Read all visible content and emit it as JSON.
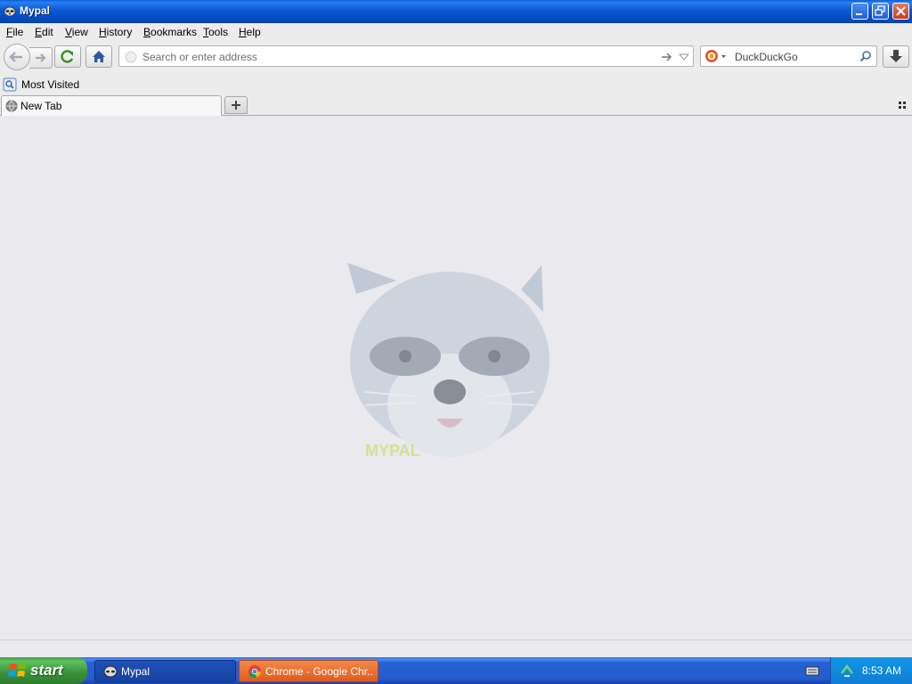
{
  "window": {
    "title": "Mypal"
  },
  "menu": [
    {
      "label": "File",
      "key": "F",
      "rest": "ile"
    },
    {
      "label": "Edit",
      "key": "E",
      "rest": "dit"
    },
    {
      "label": "View",
      "key": "V",
      "rest": "iew"
    },
    {
      "label": "History",
      "key": "H",
      "rest": "istory"
    },
    {
      "label": "Bookmarks",
      "key": "B",
      "rest": "ookmarks"
    },
    {
      "label": "Tools",
      "key": "T",
      "rest": "ools"
    },
    {
      "label": "Help",
      "key": "H",
      "rest": "elp"
    }
  ],
  "navbar": {
    "url_placeholder": "Search or enter address",
    "url_value": "",
    "search_engine": "DuckDuckGo",
    "search_placeholder": "DuckDuckGo"
  },
  "bookmarks": {
    "most_visited": "Most Visited"
  },
  "tabs": [
    {
      "label": "New Tab"
    }
  ],
  "content": {
    "logo_text": "MYPAL"
  },
  "taskbar": {
    "start": "start",
    "tasks": [
      {
        "label": "Mypal",
        "icon": "raccoon-icon"
      },
      {
        "label": "Chrome - Google Chr...",
        "icon": "chrome-icon"
      }
    ],
    "clock": "8:53 AM"
  },
  "colors": {
    "titlebar": "#0a58d3",
    "taskbar": "#245dd0",
    "start": "#399039",
    "close": "#c3401f"
  }
}
